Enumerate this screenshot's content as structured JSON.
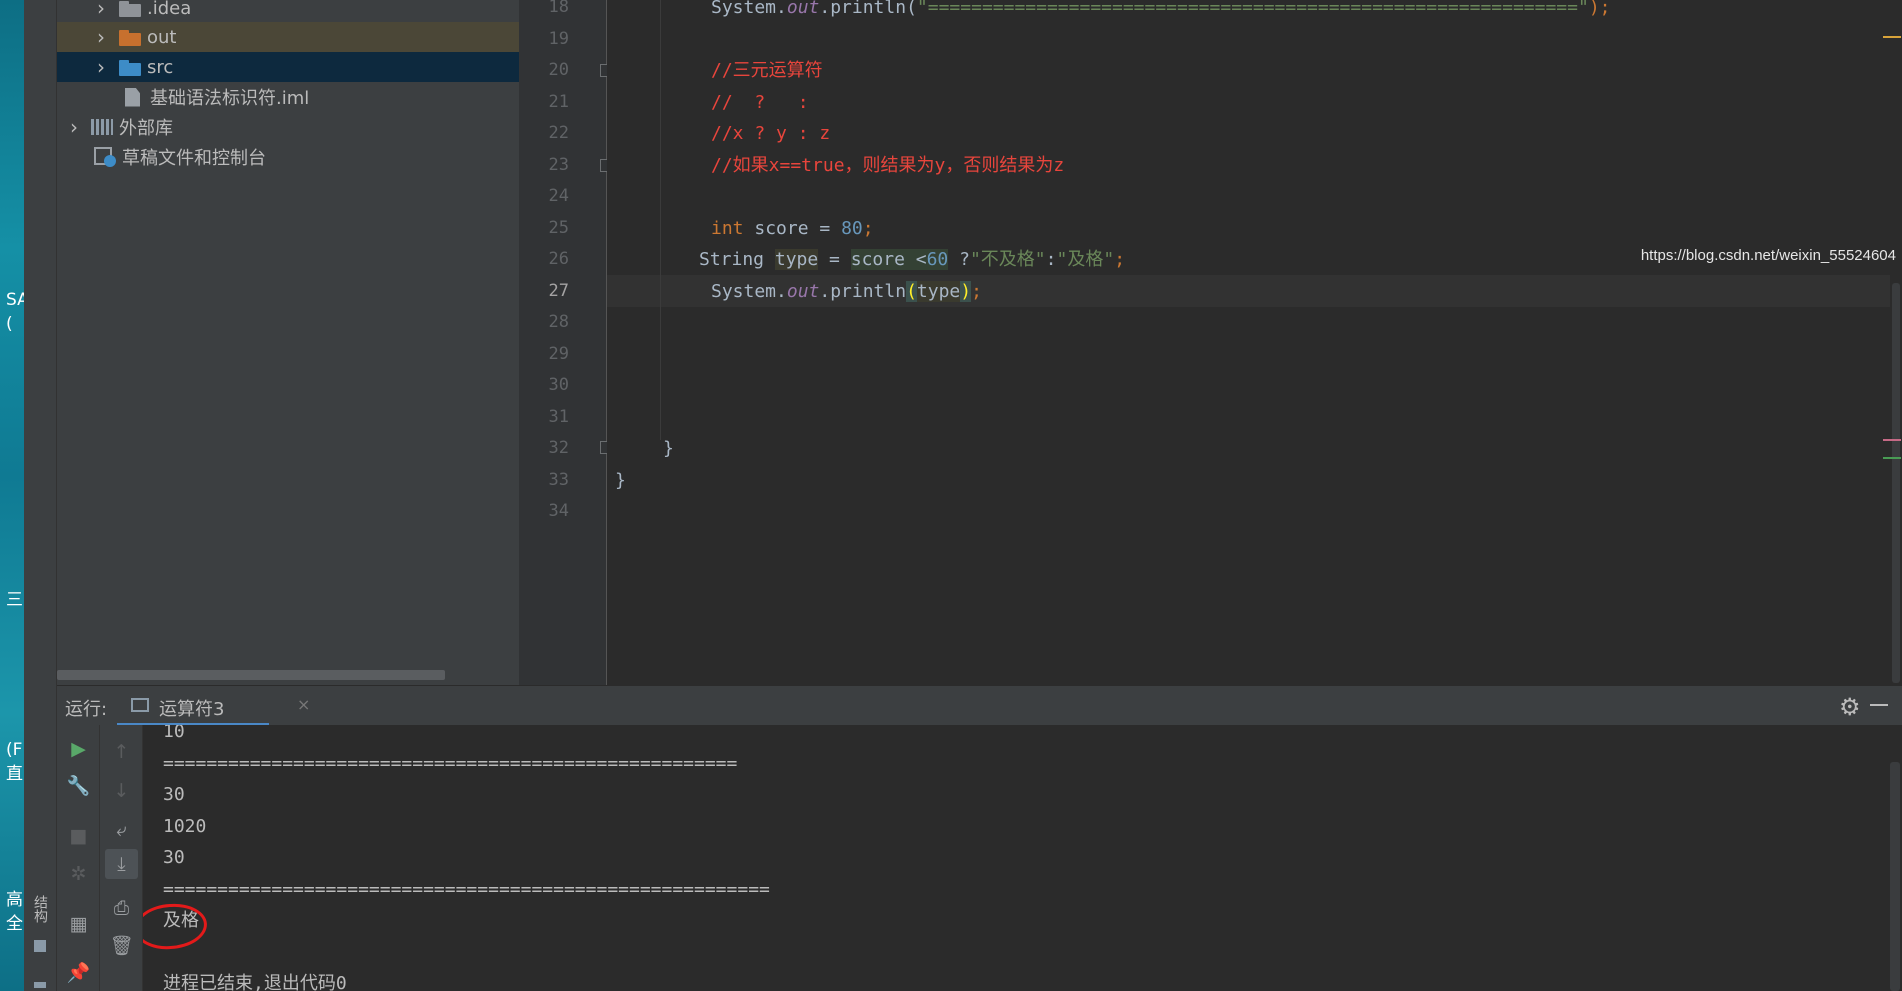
{
  "desktop": {
    "glyphs": [
      "SA",
      "(",
      "三",
      "(F",
      "直",
      "高",
      "全"
    ]
  },
  "left_strip": {
    "structure_tab": "结构"
  },
  "project_tree": {
    "items": [
      {
        "label": ".idea",
        "kind": "folder-grey",
        "state": "normal"
      },
      {
        "label": "out",
        "kind": "folder-orange",
        "state": "highlight"
      },
      {
        "label": "src",
        "kind": "folder-blue",
        "state": "selected"
      },
      {
        "label": "基础语法标识符.iml",
        "kind": "file",
        "state": "normal"
      },
      {
        "label": "外部库",
        "kind": "library",
        "state": "normal"
      },
      {
        "label": "草稿文件和控制台",
        "kind": "scratches",
        "state": "normal"
      }
    ]
  },
  "editor": {
    "line_numbers": [
      "18",
      "19",
      "20",
      "21",
      "22",
      "23",
      "24",
      "25",
      "26",
      "27",
      "28",
      "29",
      "30",
      "31",
      "32",
      "33",
      "34"
    ],
    "current_line": "27",
    "lines": {
      "l18": {
        "obj": "System.",
        "field": "out",
        "call": ".println(",
        "str": "\"============================================================\"",
        "end": ");"
      },
      "l20": "//三元运算符",
      "l21": "//  ?   :",
      "l22": "//x ? y : z",
      "l23": "//如果x==true，则结果为y，否则结果为z",
      "l25": {
        "kw": "int",
        "name": " score = ",
        "num": "80",
        "end": ";"
      },
      "l26": {
        "type": "String ",
        "var": "type",
        "eq": " = ",
        "ex1": "score <",
        "ex2": "60",
        "q": " ?",
        "s1": "\"不及格\"",
        "colon": ":",
        "s2": "\"及格\"",
        "end": ";"
      },
      "l27": {
        "obj": "System.",
        "field": "out",
        "call": ".println",
        "lp": "(",
        "arg": "type",
        "rp": ")",
        "end": ";"
      },
      "l32": "}",
      "l33": "}"
    }
  },
  "run_panel": {
    "label": "运行:",
    "tab_label": "运算符3",
    "tab_close": "×",
    "settings_icon": "gear-icon",
    "output": [
      "10",
      "=====================================================",
      "30",
      "1020",
      "30",
      "========================================================",
      "及格",
      "",
      "进程已结束,退出代码0"
    ]
  },
  "watermark": "https://blog.csdn.net/weixin_55524604",
  "colors": {
    "keyword": "#cc7832",
    "string": "#6a8759",
    "number": "#6897bb",
    "field": "#9876aa",
    "comment": "#e8453c",
    "annotation_circle": "#e31a1a",
    "selection": "#0d293e"
  }
}
